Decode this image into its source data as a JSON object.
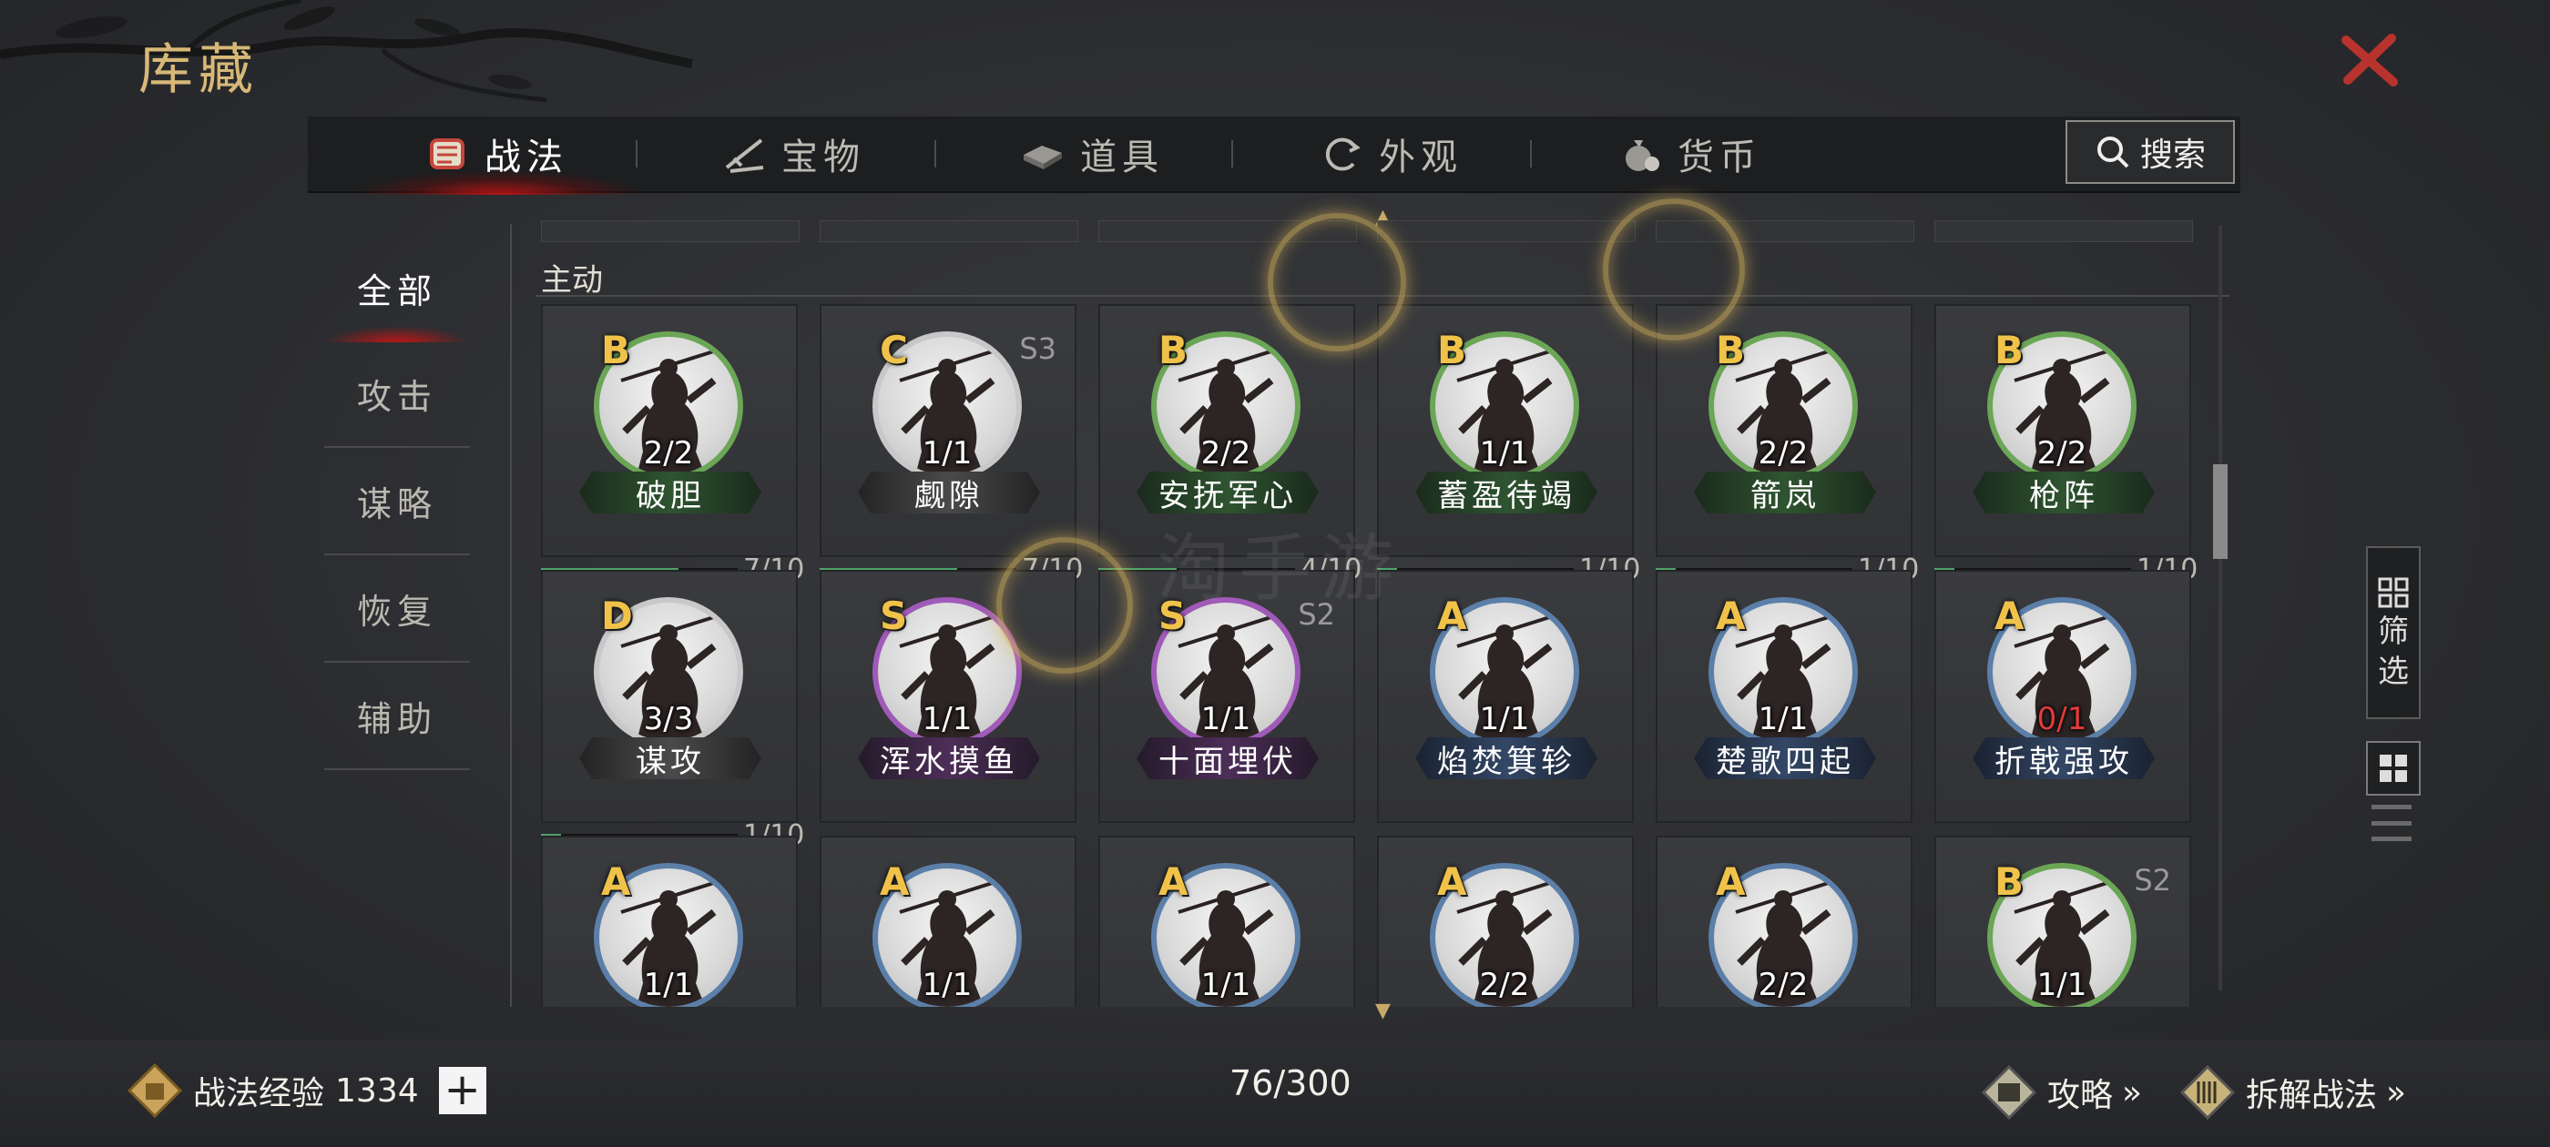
{
  "page": {
    "title": "库藏",
    "watermark": "淘手游"
  },
  "colors": {
    "accent_red": "#c01a1a",
    "gold": "#d8b877",
    "grade_gold": "#f0c24a",
    "progress_green": "#4fa268",
    "close_red": "#b8332e"
  },
  "tabs": [
    {
      "label": "战法",
      "icon": "tactics-scroll-icon",
      "active": true
    },
    {
      "label": "宝物",
      "icon": "treasure-icon",
      "active": false
    },
    {
      "label": "道具",
      "icon": "item-icon",
      "active": false
    },
    {
      "label": "外观",
      "icon": "appearance-icon",
      "active": false
    },
    {
      "label": "货币",
      "icon": "currency-bag-icon",
      "active": false
    }
  ],
  "search": {
    "label": "搜索"
  },
  "nav": [
    {
      "label": "全部",
      "active": true
    },
    {
      "label": "攻击",
      "active": false
    },
    {
      "label": "谋略",
      "active": false
    },
    {
      "label": "恢复",
      "active": false
    },
    {
      "label": "辅助",
      "active": false
    }
  ],
  "section": {
    "title": "主动"
  },
  "cards": [
    {
      "grade": "B",
      "name": "破胆",
      "count": "2/2",
      "season": "",
      "frame": "green",
      "progress": "7/10",
      "progress_value": 0.7
    },
    {
      "grade": "C",
      "name": "觑隙",
      "count": "1/1",
      "season": "S3",
      "frame": "grey",
      "progress": "7/10",
      "progress_value": 0.7
    },
    {
      "grade": "B",
      "name": "安抚军心",
      "count": "2/2",
      "season": "",
      "frame": "green",
      "progress": "4/10",
      "progress_value": 0.4
    },
    {
      "grade": "B",
      "name": "蓄盈待竭",
      "count": "1/1",
      "season": "",
      "frame": "green",
      "progress": "1/10",
      "progress_value": 0.1
    },
    {
      "grade": "B",
      "name": "箭岚",
      "count": "2/2",
      "season": "",
      "frame": "green",
      "progress": "1/10",
      "progress_value": 0.1
    },
    {
      "grade": "B",
      "name": "枪阵",
      "count": "2/2",
      "season": "",
      "frame": "green",
      "progress": "1/10",
      "progress_value": 0.1
    },
    {
      "grade": "D",
      "name": "谋攻",
      "count": "3/3",
      "season": "",
      "frame": "grey",
      "progress": "1/10",
      "progress_value": 0.1
    },
    {
      "grade": "S",
      "name": "浑水摸鱼",
      "count": "1/1",
      "season": "",
      "frame": "purple",
      "progress": "",
      "progress_value": null
    },
    {
      "grade": "S",
      "name": "十面埋伏",
      "count": "1/1",
      "season": "S2",
      "frame": "purple",
      "progress": "",
      "progress_value": null
    },
    {
      "grade": "A",
      "name": "焰焚箕轸",
      "count": "1/1",
      "season": "",
      "frame": "blue",
      "progress": "",
      "progress_value": null
    },
    {
      "grade": "A",
      "name": "楚歌四起",
      "count": "1/1",
      "season": "",
      "frame": "blue",
      "progress": "",
      "progress_value": null
    },
    {
      "grade": "A",
      "name": "折戟强攻",
      "count": "0/1",
      "season": "",
      "frame": "blue",
      "progress": "",
      "progress_value": null,
      "count_red": true
    },
    {
      "grade": "A",
      "name": "",
      "count": "1/1",
      "season": "",
      "frame": "blue",
      "progress": "",
      "progress_value": null
    },
    {
      "grade": "A",
      "name": "",
      "count": "1/1",
      "season": "",
      "frame": "blue",
      "progress": "",
      "progress_value": null
    },
    {
      "grade": "A",
      "name": "",
      "count": "1/1",
      "season": "",
      "frame": "blue",
      "progress": "",
      "progress_value": null
    },
    {
      "grade": "A",
      "name": "",
      "count": "2/2",
      "season": "",
      "frame": "blue",
      "progress": "",
      "progress_value": null
    },
    {
      "grade": "A",
      "name": "",
      "count": "2/2",
      "season": "",
      "frame": "blue",
      "progress": "",
      "progress_value": null
    },
    {
      "grade": "B",
      "name": "",
      "count": "1/1",
      "season": "S2",
      "frame": "green",
      "progress": "",
      "progress_value": null
    }
  ],
  "filter": {
    "label_1": "筛",
    "label_2": "选"
  },
  "bottom": {
    "exp_label": "战法经验",
    "exp_value": "1334",
    "plus": "+",
    "capacity": "76/300",
    "guide_label": "攻略",
    "guide_arrow": "»",
    "dismantle_label": "拆解战法",
    "dismantle_arrow": "»"
  }
}
